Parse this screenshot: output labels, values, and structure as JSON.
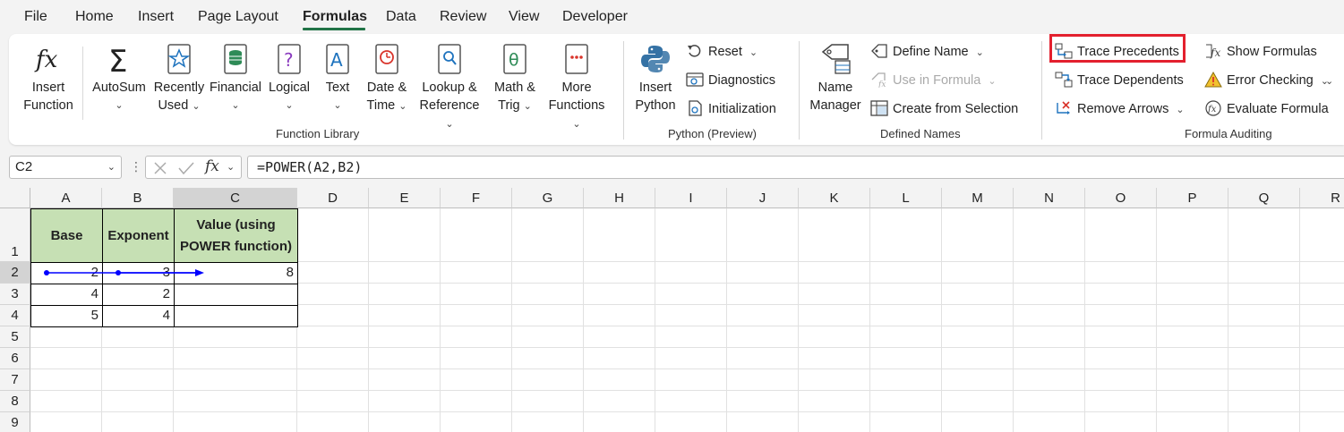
{
  "menu": {
    "tabs": [
      {
        "label": "File"
      },
      {
        "label": "Home"
      },
      {
        "label": "Insert"
      },
      {
        "label": "Page Layout"
      },
      {
        "label": "Formulas"
      },
      {
        "label": "Data"
      },
      {
        "label": "Review"
      },
      {
        "label": "View"
      },
      {
        "label": "Developer"
      }
    ],
    "active": "Formulas"
  },
  "ribbon": {
    "function_library": {
      "label": "Function Library",
      "insert_function": {
        "line1": "Insert",
        "line2": "Function"
      },
      "autosum": {
        "label": "AutoSum"
      },
      "recently_used": {
        "line1": "Recently",
        "line2": "Used"
      },
      "financial": {
        "label": "Financial"
      },
      "logical": {
        "label": "Logical"
      },
      "text": {
        "label": "Text"
      },
      "date_time": {
        "line1": "Date &",
        "line2": "Time"
      },
      "lookup": {
        "line1": "Lookup &",
        "line2": "Reference"
      },
      "math": {
        "line1": "Math &",
        "line2": "Trig"
      },
      "more": {
        "line1": "More",
        "line2": "Functions"
      }
    },
    "python": {
      "label": "Python (Preview)",
      "insert_python": {
        "line1": "Insert",
        "line2": "Python"
      },
      "reset": "Reset",
      "diagnostics": "Diagnostics",
      "initialization": "Initialization"
    },
    "defined_names": {
      "label": "Defined Names",
      "name_manager": {
        "line1": "Name",
        "line2": "Manager"
      },
      "define_name": "Define Name",
      "use_in_formula": "Use in Formula",
      "create_from_selection": "Create from Selection"
    },
    "formula_auditing": {
      "label": "Formula Auditing",
      "trace_precedents": "Trace Precedents",
      "trace_dependents": "Trace Dependents",
      "remove_arrows": "Remove Arrows",
      "show_formulas": "Show Formulas",
      "error_checking": "Error Checking",
      "evaluate_formula": "Evaluate Formula"
    }
  },
  "formula_bar": {
    "name_box": "C2",
    "fx": "fx",
    "formula": "=POWER(A2,B2)"
  },
  "sheet": {
    "columns": [
      "A",
      "B",
      "C",
      "D",
      "E",
      "F",
      "G",
      "H",
      "I",
      "J",
      "K",
      "L",
      "M",
      "N",
      "O",
      "P",
      "Q",
      "R"
    ],
    "rows": [
      "1",
      "2",
      "3",
      "4",
      "5",
      "6",
      "7",
      "8",
      "9"
    ],
    "selected_column": "C",
    "selected_row": "2",
    "headers": {
      "a": "Base",
      "b": "Exponent",
      "c": "Value (using POWER function)"
    },
    "data": [
      {
        "a": "2",
        "b": "3",
        "c": "8"
      },
      {
        "a": "4",
        "b": "2",
        "c": ""
      },
      {
        "a": "5",
        "b": "4",
        "c": ""
      }
    ],
    "colors": {
      "header_fill": "#c6e0b4",
      "trace_arrow": "#0000ff",
      "highlight": "#e3202e",
      "accent": "#217346"
    }
  }
}
